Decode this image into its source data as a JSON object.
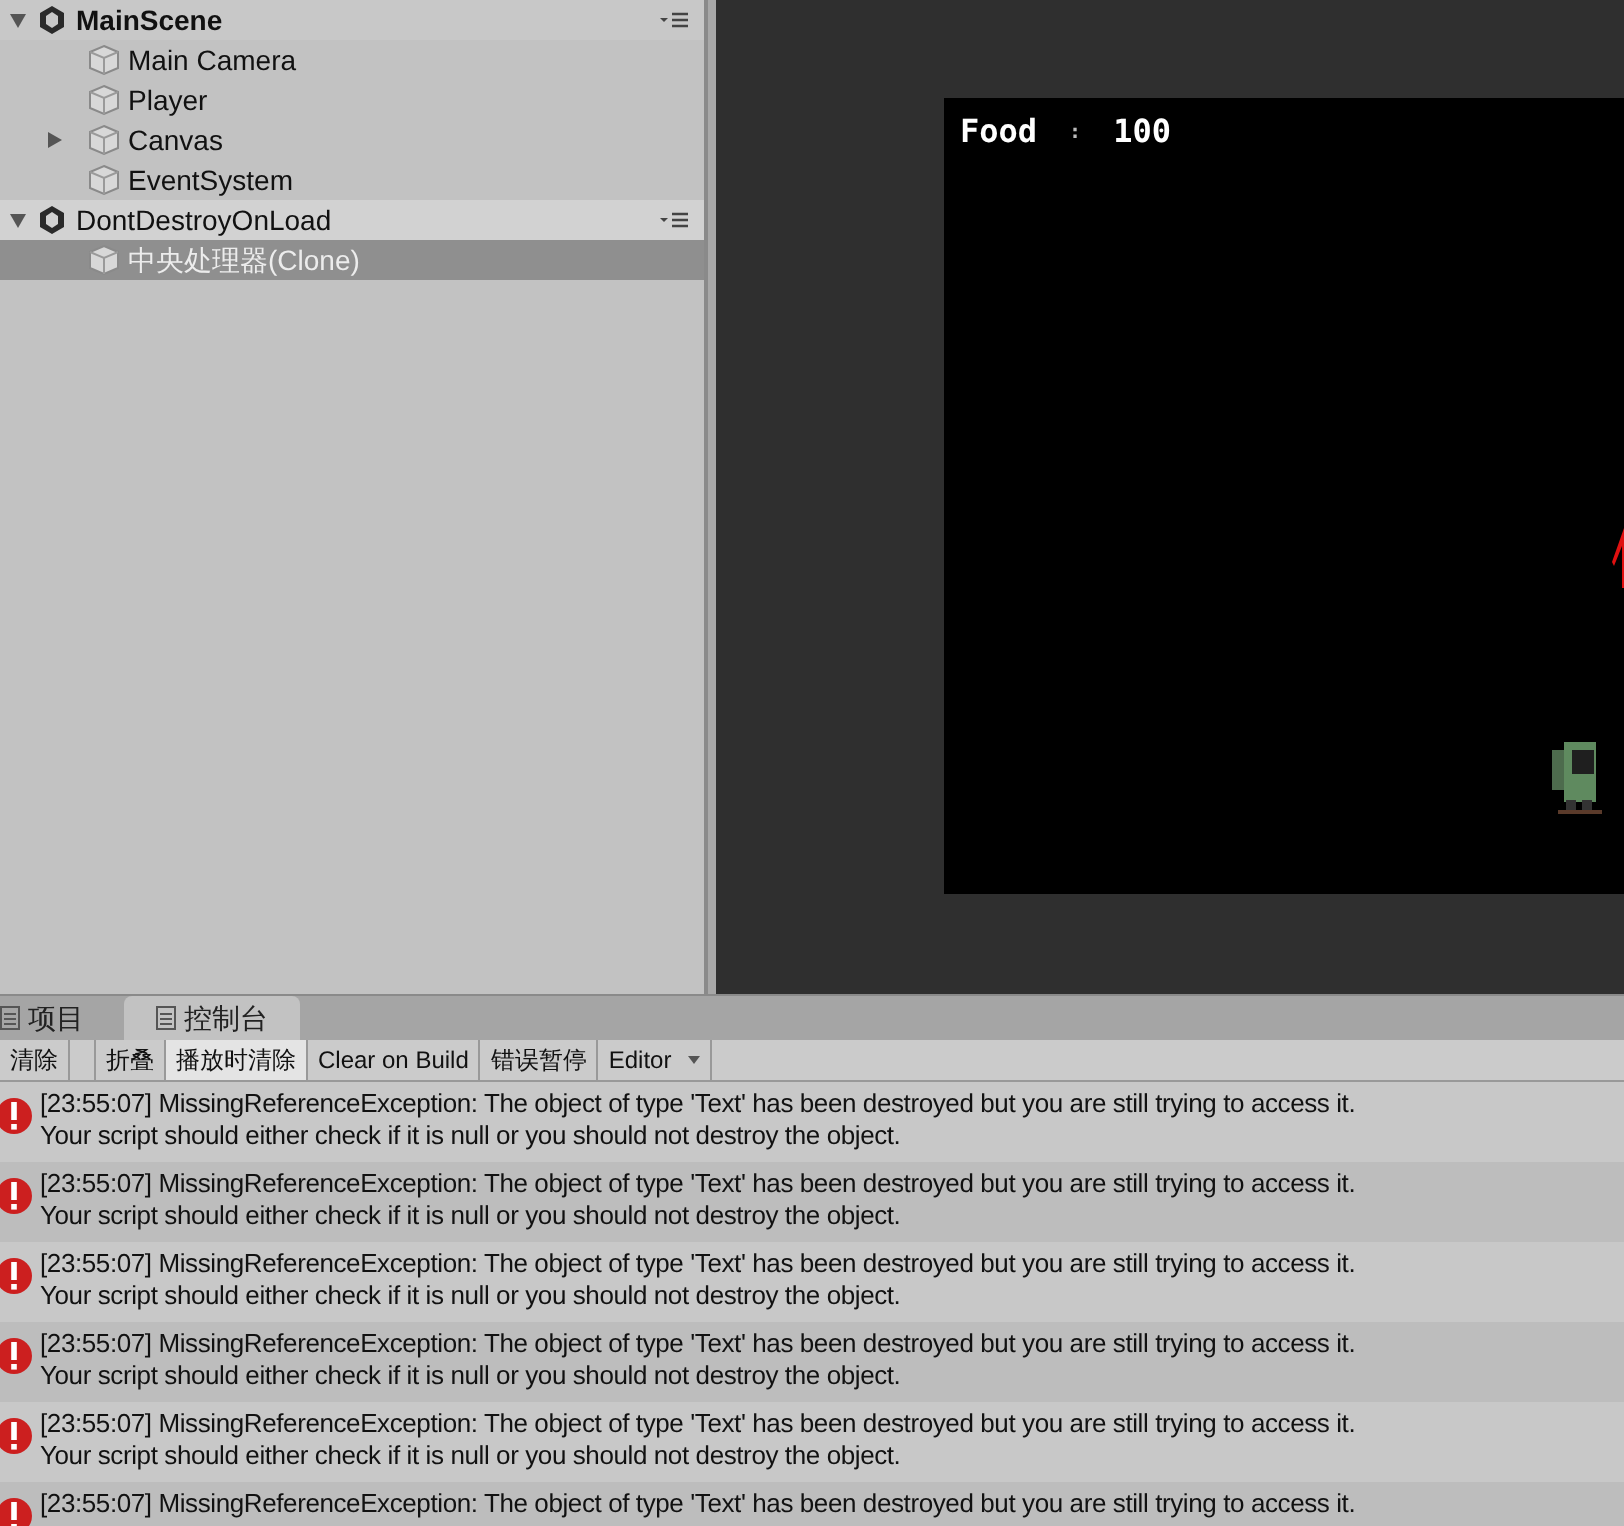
{
  "hierarchy": {
    "scenes": [
      {
        "name": "MainScene",
        "active": true,
        "children": [
          {
            "name": "Main Camera",
            "expandable": false,
            "selected": false
          },
          {
            "name": "Player",
            "expandable": false,
            "selected": false
          },
          {
            "name": "Canvas",
            "expandable": true,
            "selected": false
          },
          {
            "name": "EventSystem",
            "expandable": false,
            "selected": false
          }
        ]
      },
      {
        "name": "DontDestroyOnLoad",
        "active": false,
        "children": [
          {
            "name": "中央处理器(Clone)",
            "expandable": false,
            "selected": true
          }
        ]
      }
    ]
  },
  "game_view": {
    "food_label": "Food",
    "separator": ":",
    "food_value": "100"
  },
  "console": {
    "tabs": [
      {
        "label": "项目",
        "selected": false
      },
      {
        "label": "控制台",
        "selected": true
      }
    ],
    "toolbar": [
      {
        "label": "清除",
        "kind": "button",
        "selected": false
      },
      {
        "label": "折叠",
        "kind": "button",
        "selected": false
      },
      {
        "label": "播放时清除",
        "kind": "button",
        "selected": true
      },
      {
        "label": "Clear on Build",
        "kind": "button",
        "selected": false
      },
      {
        "label": "错误暂停",
        "kind": "button",
        "selected": false
      },
      {
        "label": "Editor",
        "kind": "dropdown",
        "selected": false
      }
    ],
    "entries": [
      {
        "line1": "[23:55:07] MissingReferenceException: The object of type 'Text' has been destroyed but you are still trying to access it.",
        "line2": "Your script should either check if it is null or you should not destroy the object."
      },
      {
        "line1": "[23:55:07] MissingReferenceException: The object of type 'Text' has been destroyed but you are still trying to access it.",
        "line2": "Your script should either check if it is null or you should not destroy the object."
      },
      {
        "line1": "[23:55:07] MissingReferenceException: The object of type 'Text' has been destroyed but you are still trying to access it.",
        "line2": "Your script should either check if it is null or you should not destroy the object."
      },
      {
        "line1": "[23:55:07] MissingReferenceException: The object of type 'Text' has been destroyed but you are still trying to access it.",
        "line2": "Your script should either check if it is null or you should not destroy the object."
      },
      {
        "line1": "[23:55:07] MissingReferenceException: The object of type 'Text' has been destroyed but you are still trying to access it.",
        "line2": "Your script should either check if it is null or you should not destroy the object."
      },
      {
        "line1": "[23:55:07] MissingReferenceException: The object of type 'Text' has been destroyed but you are still trying to access it."
      }
    ]
  }
}
